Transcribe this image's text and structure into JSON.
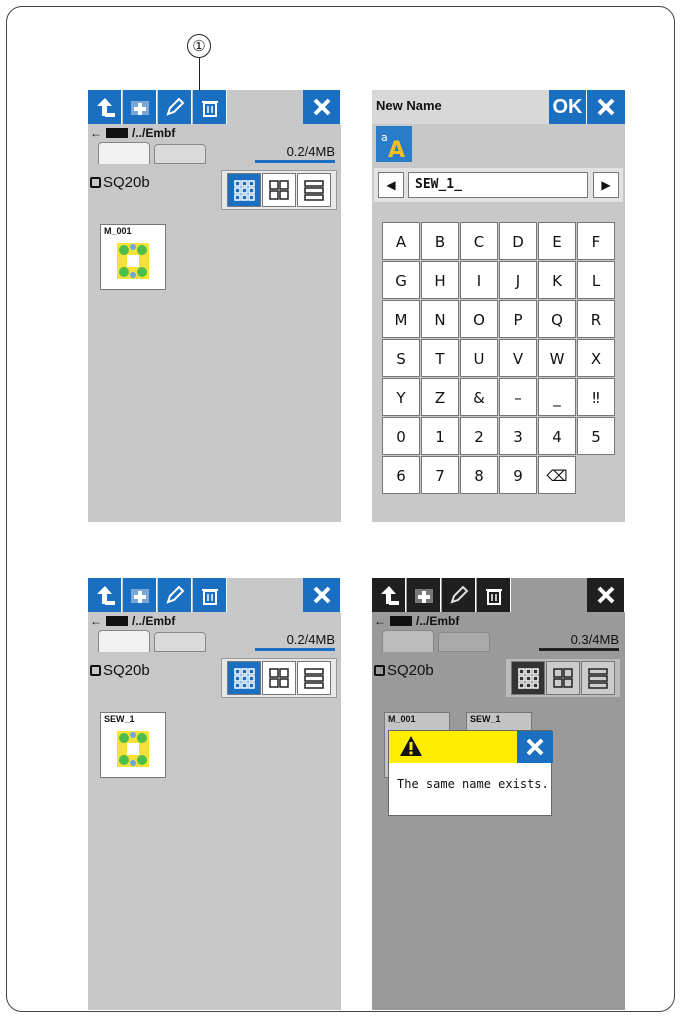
{
  "callout": {
    "number": "①"
  },
  "file_manager": {
    "path_text": "/../Embf",
    "memory_before": "0.2/4MB",
    "memory_after": "0.3/4MB",
    "device_label": "SQ20b",
    "file_original": "M_001",
    "file_renamed": "SEW_1"
  },
  "rename_dialog": {
    "title": "New Name",
    "ok_label": "OK",
    "current_value": "SEW_1_",
    "prev_arrow": "◀",
    "next_arrow": "▶",
    "keys": [
      [
        "A",
        "B",
        "C",
        "D",
        "E",
        "F"
      ],
      [
        "G",
        "H",
        "I",
        "J",
        "K",
        "L"
      ],
      [
        "M",
        "N",
        "O",
        "P",
        "Q",
        "R"
      ],
      [
        "S",
        "T",
        "U",
        "V",
        "W",
        "X"
      ],
      [
        "Y",
        "Z",
        "&",
        "–",
        "_",
        "‼"
      ],
      [
        "0",
        "1",
        "2",
        "3",
        "4",
        "5"
      ],
      [
        "6",
        "7",
        "8",
        "9",
        "⌫"
      ]
    ]
  },
  "alert": {
    "message": "The same name exists."
  },
  "colors": {
    "accent": "#1a6fc0",
    "alert": "#ffee00",
    "dim_toolbar": "#1f1f1f"
  }
}
